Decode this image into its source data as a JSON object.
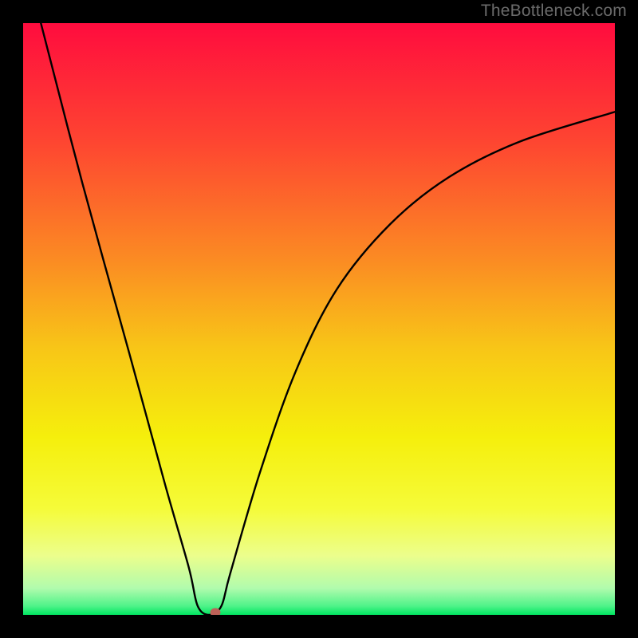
{
  "watermark": "TheBottleneck.com",
  "chart_data": {
    "type": "line",
    "title": "",
    "xlabel": "",
    "ylabel": "",
    "xlim": [
      0,
      100
    ],
    "ylim": [
      0,
      100
    ],
    "grid": false,
    "legend": false,
    "curve": [
      {
        "x": 3.0,
        "y": 100.0
      },
      {
        "x": 10.0,
        "y": 73.0
      },
      {
        "x": 18.0,
        "y": 44.0
      },
      {
        "x": 24.0,
        "y": 22.0
      },
      {
        "x": 28.0,
        "y": 8.0
      },
      {
        "x": 29.5,
        "y": 1.5
      },
      {
        "x": 31.5,
        "y": 0.0
      },
      {
        "x": 33.5,
        "y": 1.5
      },
      {
        "x": 35.0,
        "y": 7.0
      },
      {
        "x": 40.0,
        "y": 24.0
      },
      {
        "x": 46.0,
        "y": 41.0
      },
      {
        "x": 53.0,
        "y": 55.0
      },
      {
        "x": 62.0,
        "y": 66.0
      },
      {
        "x": 72.0,
        "y": 74.0
      },
      {
        "x": 84.0,
        "y": 80.0
      },
      {
        "x": 100.0,
        "y": 85.0
      }
    ],
    "marker": {
      "x": 32.5,
      "y": 0.0
    },
    "background_gradient": {
      "stops": [
        {
          "pos": 0.0,
          "color": "#ff0c3e"
        },
        {
          "pos": 0.2,
          "color": "#fe4531"
        },
        {
          "pos": 0.4,
          "color": "#fb8b23"
        },
        {
          "pos": 0.55,
          "color": "#f8c617"
        },
        {
          "pos": 0.7,
          "color": "#f5ef0c"
        },
        {
          "pos": 0.82,
          "color": "#f5fb39"
        },
        {
          "pos": 0.9,
          "color": "#ecfe8c"
        },
        {
          "pos": 0.955,
          "color": "#b1fbad"
        },
        {
          "pos": 0.985,
          "color": "#4ff389"
        },
        {
          "pos": 1.0,
          "color": "#00e661"
        }
      ]
    }
  }
}
